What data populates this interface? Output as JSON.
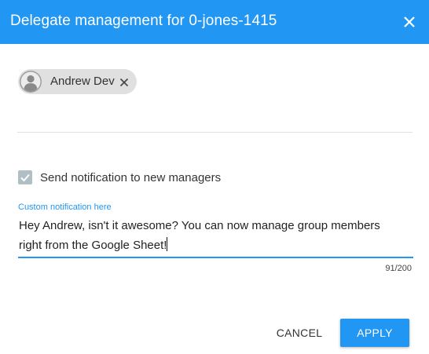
{
  "dialog": {
    "title": "Delegate management for 0-jones-1415",
    "close_icon": "close-icon"
  },
  "managers": [
    {
      "name": "Andrew Dev",
      "avatar_icon": "person-icon",
      "remove_icon": "close-icon"
    }
  ],
  "notification": {
    "checkbox_label": "Send notification to new managers",
    "checked": true,
    "field_label": "Custom notification here",
    "message_line1": "Hey Andrew, isn't it awesome? You can now manage group members",
    "message_line2": "right from the Google Sheet!",
    "char_count": "91/200"
  },
  "actions": {
    "cancel_label": "CANCEL",
    "apply_label": "APPLY"
  },
  "colors": {
    "accent": "#2196f3",
    "chip_bg": "#e0e0e0",
    "checkbox_bg": "#b0bec5"
  }
}
